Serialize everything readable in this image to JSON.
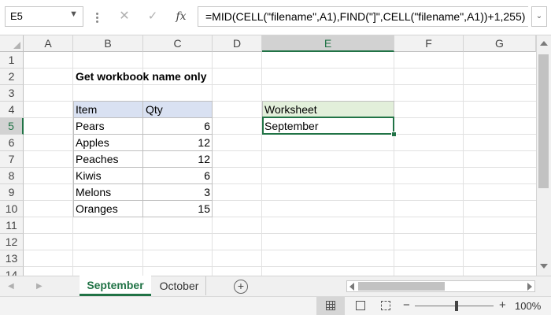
{
  "formula_bar": {
    "name_box": "E5",
    "formula": "=MID(CELL(\"filename\",A1),FIND(\"]\",CELL(\"filename\",A1))+1,255)",
    "cancel_icon": "cancel-x-icon",
    "enter_icon": "checkmark-icon",
    "fx_label": "fx"
  },
  "grid": {
    "columns": [
      "A",
      "B",
      "C",
      "D",
      "E",
      "F",
      "G"
    ],
    "rows": [
      "1",
      "2",
      "3",
      "4",
      "5",
      "6",
      "7",
      "8",
      "9",
      "10",
      "11",
      "12",
      "13",
      "14"
    ],
    "selected_column": "E",
    "selected_row": "5"
  },
  "sheet": {
    "title": "Get workbook name only",
    "table": {
      "headers": [
        "Item",
        "Qty"
      ],
      "rows": [
        {
          "item": "Pears",
          "qty": "6"
        },
        {
          "item": "Apples",
          "qty": "12"
        },
        {
          "item": "Peaches",
          "qty": "12"
        },
        {
          "item": "Kiwis",
          "qty": "6"
        },
        {
          "item": "Melons",
          "qty": "3"
        },
        {
          "item": "Oranges",
          "qty": "15"
        }
      ]
    },
    "worksheet_header": "Worksheet",
    "worksheet_value": "September"
  },
  "tabs": {
    "items": [
      "September",
      "October"
    ],
    "active": "September",
    "add_icon": "plus-circle-icon"
  },
  "status_bar": {
    "zoom_level": "100%",
    "zoom_minus": "−",
    "zoom_plus": "+"
  },
  "colors": {
    "accent": "#217346",
    "table_header": "#d9e1f2",
    "worksheet_header": "#e2efda"
  }
}
